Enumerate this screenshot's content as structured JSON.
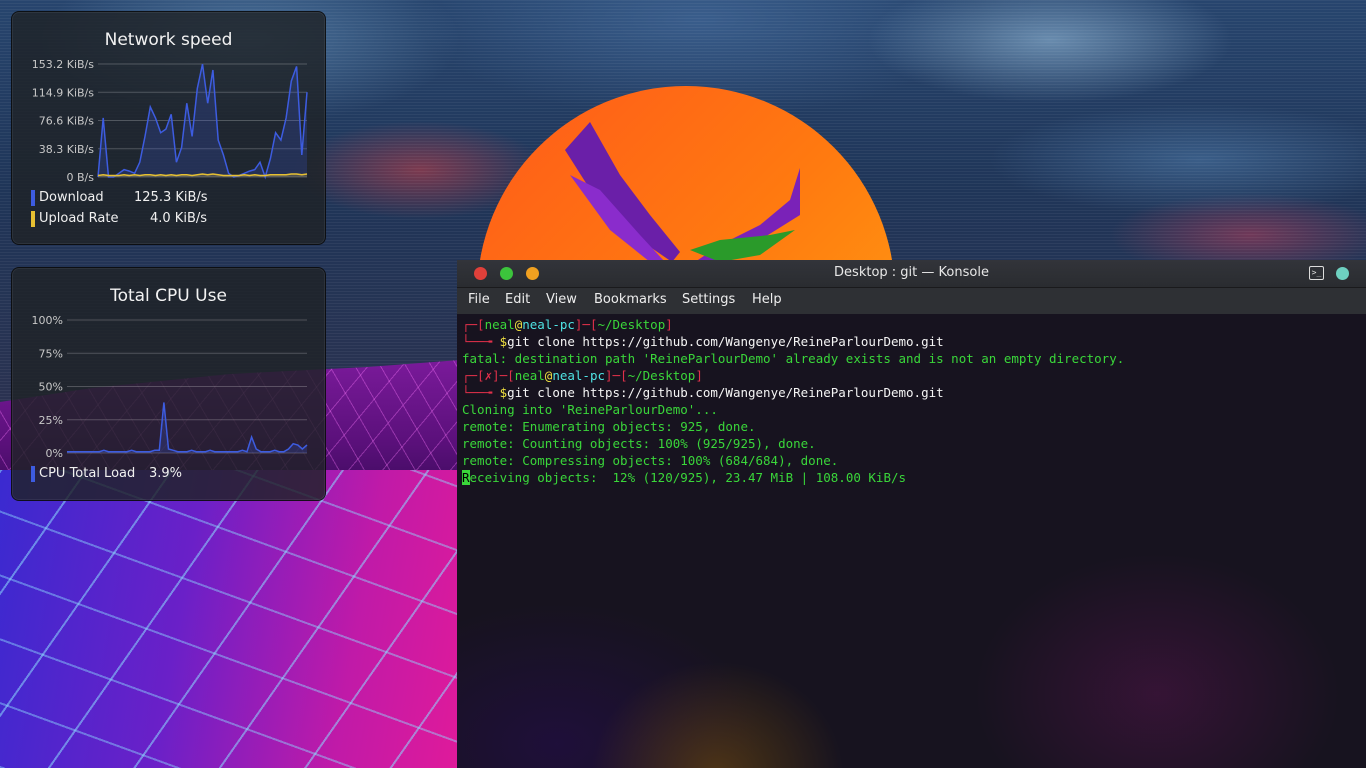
{
  "network_widget": {
    "title": "Network speed",
    "y_ticks": [
      "153.2 KiB/s",
      "114.9 KiB/s",
      "76.6 KiB/s",
      "38.3 KiB/s",
      "0 B/s"
    ],
    "legend": [
      {
        "label": "Download",
        "value": "125.3 KiB/s",
        "color": "#3d5ce0"
      },
      {
        "label": "Upload Rate",
        "value": "4.0 KiB/s",
        "color": "#e6c032"
      }
    ]
  },
  "cpu_widget": {
    "title": "Total CPU Use",
    "y_ticks": [
      "100%",
      "75%",
      "50%",
      "25%",
      "0%"
    ],
    "legend": [
      {
        "label": "CPU Total Load",
        "value": "3.9%",
        "color": "#3d5ce0"
      }
    ]
  },
  "chart_data": [
    {
      "type": "area",
      "title": "Network speed",
      "ylim": [
        0,
        153.2
      ],
      "y_unit": "KiB/s",
      "grid": true,
      "series": [
        {
          "name": "Download",
          "color": "#3d5ce0",
          "values": [
            0,
            80,
            0,
            0,
            5,
            10,
            8,
            5,
            20,
            55,
            95,
            80,
            60,
            65,
            85,
            20,
            40,
            100,
            55,
            120,
            153,
            100,
            145,
            50,
            30,
            5,
            0,
            2,
            5,
            8,
            10,
            20,
            0,
            25,
            60,
            50,
            80,
            130,
            150,
            30,
            115
          ]
        },
        {
          "name": "Upload Rate",
          "color": "#e6c032",
          "values": [
            2,
            3,
            2,
            2,
            2,
            3,
            2,
            3,
            2,
            3,
            3,
            2,
            3,
            2,
            3,
            2,
            3,
            3,
            2,
            3,
            4,
            3,
            4,
            3,
            2,
            2,
            2,
            2,
            3,
            2,
            3,
            2,
            2,
            3,
            3,
            3,
            3,
            4,
            4,
            3,
            4
          ]
        }
      ]
    },
    {
      "type": "area",
      "title": "Total CPU Use",
      "ylim": [
        0,
        100
      ],
      "y_unit": "%",
      "grid": true,
      "series": [
        {
          "name": "CPU Total Load",
          "color": "#3d5ce0",
          "values": [
            1,
            1,
            1,
            1,
            1,
            1,
            1,
            1,
            2,
            1,
            1,
            1,
            1,
            1,
            2,
            1,
            1,
            1,
            1,
            2,
            2,
            38,
            3,
            2,
            1,
            1,
            1,
            2,
            1,
            1,
            1,
            2,
            1,
            1,
            1,
            1,
            1,
            1,
            2,
            1,
            12,
            3,
            1,
            1,
            1,
            2,
            1,
            1,
            3,
            7,
            6,
            3,
            6
          ]
        }
      ]
    }
  ],
  "konsole": {
    "title": "Desktop : git — Konsole",
    "menu": [
      "File",
      "Edit",
      "View",
      "Bookmarks",
      "Settings",
      "Help"
    ],
    "prompt_user": "neal",
    "prompt_at": "@",
    "prompt_host": "neal-pc",
    "prompt_dir": "~/Desktop",
    "prompt_fail_mark": "✗",
    "command": "git clone https://github.com/Wangenye/ReineParlourDemo.git",
    "output_fatal": "fatal: destination path 'ReineParlourDemo' already exists and is not an empty directory.",
    "output_lines": [
      "Cloning into 'ReineParlourDemo'...",
      "remote: Enumerating objects: 925, done.",
      "remote: Counting objects: 100% (925/925), done.",
      "remote: Compressing objects: 100% (684/684), done."
    ],
    "progress_cursor_char": "R",
    "progress_rest": "eceiving objects:  12% (120/925), 23.47 MiB | 108.00 KiB/s"
  },
  "colors": {
    "terminal_red": "#e0304a",
    "terminal_green": "#3ad63a",
    "terminal_cyan": "#4fe3e3",
    "terminal_yellow": "#f0e040",
    "close": "#e0403a",
    "maximize": "#3cc43c",
    "minimize": "#f0a020",
    "keep_above": "#6ed0c0"
  }
}
